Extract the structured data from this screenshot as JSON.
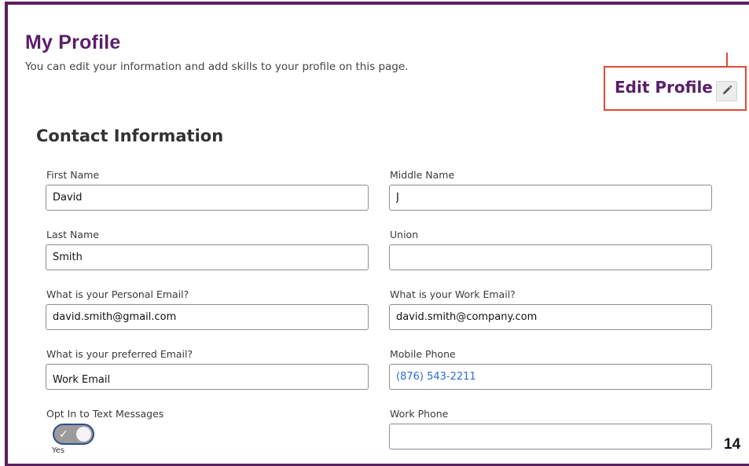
{
  "header": {
    "title": "My Profile",
    "subtitle": "You can edit your information and add skills to your profile on this page.",
    "edit_label": "Edit Profile",
    "edit_icon": "pencil-icon"
  },
  "contact": {
    "section_title": "Contact Information",
    "first_name": {
      "label": "First Name",
      "value": "David"
    },
    "middle_name": {
      "label": "Middle Name",
      "value": "J"
    },
    "last_name": {
      "label": "Last Name",
      "value": "Smith"
    },
    "union": {
      "label": "Union",
      "value": ""
    },
    "personal_email": {
      "label": "What is your Personal Email?",
      "value": "david.smith@gmail.com"
    },
    "work_email": {
      "label": "What is your Work Email?",
      "value": "david.smith@company.com"
    },
    "preferred_email": {
      "label": "What is your preferred Email?",
      "value": "Work Email"
    },
    "mobile_phone": {
      "label": "Mobile Phone",
      "value": "(876) 543-2211"
    },
    "opt_in": {
      "label": "Opt In to Text Messages",
      "state": "Yes",
      "checked": true
    },
    "work_phone": {
      "label": "Work Phone",
      "value": ""
    }
  },
  "annotation": {
    "page_number": "14",
    "highlight_color": "#e04a35"
  },
  "colors": {
    "brand": "#5a1f6a",
    "link": "#2b6cd4"
  }
}
